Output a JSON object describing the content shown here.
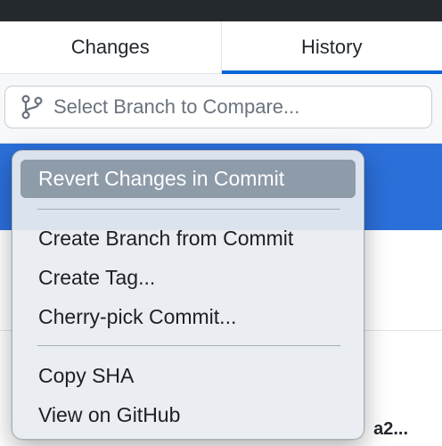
{
  "tabs": [
    {
      "label": "Changes",
      "active": false
    },
    {
      "label": "History",
      "active": true
    }
  ],
  "branch_selector": {
    "icon": "git-branch-icon",
    "placeholder": "Select Branch to Compare..."
  },
  "history": {
    "partial_row_text": "a2..."
  },
  "context_menu": {
    "groups": [
      [
        {
          "label": "Revert Changes in Commit",
          "highlighted": true
        }
      ],
      [
        {
          "label": "Create Branch from Commit"
        },
        {
          "label": "Create Tag..."
        },
        {
          "label": "Cherry-pick Commit..."
        }
      ],
      [
        {
          "label": "Copy SHA"
        },
        {
          "label": "View on GitHub"
        }
      ]
    ]
  },
  "colors": {
    "selection": "#2b6fd9",
    "tab_indicator": "#0366d6",
    "menu_highlight": "#8e9ba9"
  }
}
